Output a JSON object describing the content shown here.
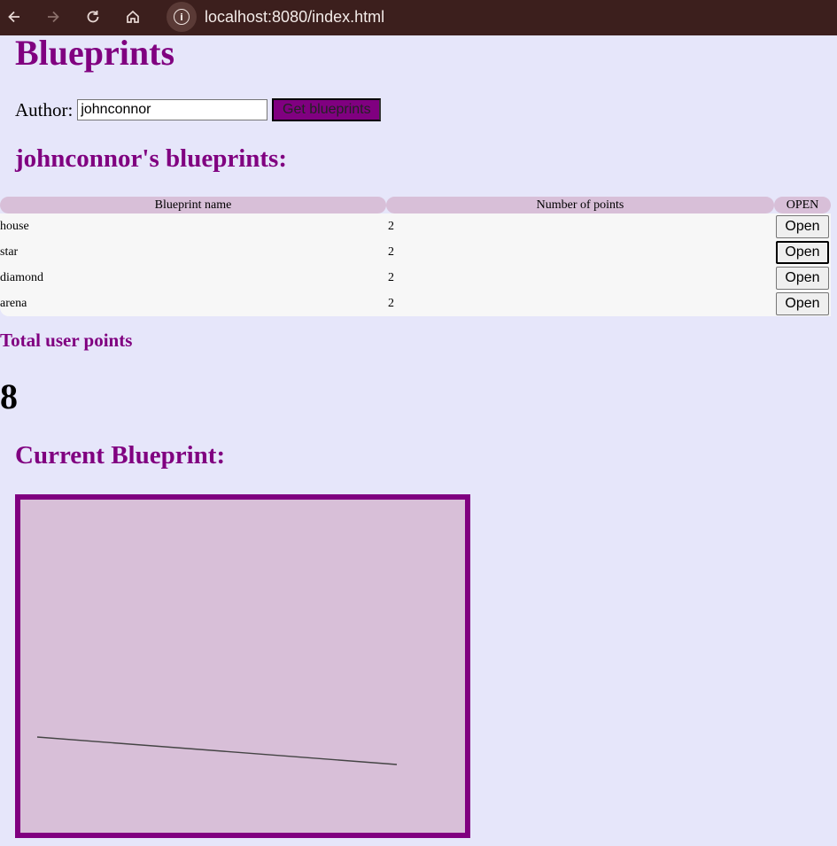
{
  "browser": {
    "url": "localhost:8080/index.html",
    "back_icon": "arrow-left-icon",
    "forward_icon": "arrow-right-icon",
    "reload_icon": "reload-icon",
    "home_icon": "home-icon",
    "info_icon": "info-icon"
  },
  "page": {
    "title": "Blueprints",
    "author_label": "Author:",
    "author_value": "johnconnor",
    "get_button": "Get blueprints",
    "subtitle": "johnconnor's blueprints:",
    "table": {
      "headers": [
        "Blueprint name",
        "Number of points",
        "OPEN"
      ],
      "rows": [
        {
          "name": "house",
          "points": "2",
          "action": "Open"
        },
        {
          "name": "star",
          "points": "2",
          "action": "Open"
        },
        {
          "name": "diamond",
          "points": "2",
          "action": "Open"
        },
        {
          "name": "arena",
          "points": "2",
          "action": "Open"
        }
      ]
    },
    "total_label": "Total user points",
    "total_value": "8",
    "current_label": "Current Blueprint:"
  },
  "colors": {
    "accent": "#800080",
    "background": "#e6e6fa",
    "header_bg": "#d8bfd8",
    "canvas_bg": "#d8bfd8"
  }
}
